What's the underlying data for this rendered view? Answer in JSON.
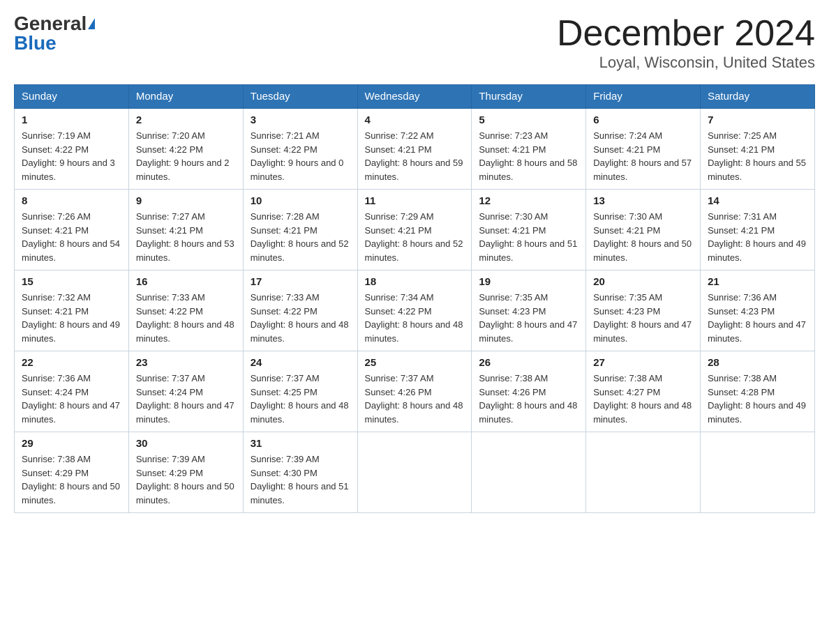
{
  "header": {
    "logo_general": "General",
    "logo_blue": "Blue",
    "month_title": "December 2024",
    "location": "Loyal, Wisconsin, United States"
  },
  "days_of_week": [
    "Sunday",
    "Monday",
    "Tuesday",
    "Wednesday",
    "Thursday",
    "Friday",
    "Saturday"
  ],
  "weeks": [
    [
      {
        "day": "1",
        "sunrise": "7:19 AM",
        "sunset": "4:22 PM",
        "daylight": "9 hours and 3 minutes."
      },
      {
        "day": "2",
        "sunrise": "7:20 AM",
        "sunset": "4:22 PM",
        "daylight": "9 hours and 2 minutes."
      },
      {
        "day": "3",
        "sunrise": "7:21 AM",
        "sunset": "4:22 PM",
        "daylight": "9 hours and 0 minutes."
      },
      {
        "day": "4",
        "sunrise": "7:22 AM",
        "sunset": "4:21 PM",
        "daylight": "8 hours and 59 minutes."
      },
      {
        "day": "5",
        "sunrise": "7:23 AM",
        "sunset": "4:21 PM",
        "daylight": "8 hours and 58 minutes."
      },
      {
        "day": "6",
        "sunrise": "7:24 AM",
        "sunset": "4:21 PM",
        "daylight": "8 hours and 57 minutes."
      },
      {
        "day": "7",
        "sunrise": "7:25 AM",
        "sunset": "4:21 PM",
        "daylight": "8 hours and 55 minutes."
      }
    ],
    [
      {
        "day": "8",
        "sunrise": "7:26 AM",
        "sunset": "4:21 PM",
        "daylight": "8 hours and 54 minutes."
      },
      {
        "day": "9",
        "sunrise": "7:27 AM",
        "sunset": "4:21 PM",
        "daylight": "8 hours and 53 minutes."
      },
      {
        "day": "10",
        "sunrise": "7:28 AM",
        "sunset": "4:21 PM",
        "daylight": "8 hours and 52 minutes."
      },
      {
        "day": "11",
        "sunrise": "7:29 AM",
        "sunset": "4:21 PM",
        "daylight": "8 hours and 52 minutes."
      },
      {
        "day": "12",
        "sunrise": "7:30 AM",
        "sunset": "4:21 PM",
        "daylight": "8 hours and 51 minutes."
      },
      {
        "day": "13",
        "sunrise": "7:30 AM",
        "sunset": "4:21 PM",
        "daylight": "8 hours and 50 minutes."
      },
      {
        "day": "14",
        "sunrise": "7:31 AM",
        "sunset": "4:21 PM",
        "daylight": "8 hours and 49 minutes."
      }
    ],
    [
      {
        "day": "15",
        "sunrise": "7:32 AM",
        "sunset": "4:21 PM",
        "daylight": "8 hours and 49 minutes."
      },
      {
        "day": "16",
        "sunrise": "7:33 AM",
        "sunset": "4:22 PM",
        "daylight": "8 hours and 48 minutes."
      },
      {
        "day": "17",
        "sunrise": "7:33 AM",
        "sunset": "4:22 PM",
        "daylight": "8 hours and 48 minutes."
      },
      {
        "day": "18",
        "sunrise": "7:34 AM",
        "sunset": "4:22 PM",
        "daylight": "8 hours and 48 minutes."
      },
      {
        "day": "19",
        "sunrise": "7:35 AM",
        "sunset": "4:23 PM",
        "daylight": "8 hours and 47 minutes."
      },
      {
        "day": "20",
        "sunrise": "7:35 AM",
        "sunset": "4:23 PM",
        "daylight": "8 hours and 47 minutes."
      },
      {
        "day": "21",
        "sunrise": "7:36 AM",
        "sunset": "4:23 PM",
        "daylight": "8 hours and 47 minutes."
      }
    ],
    [
      {
        "day": "22",
        "sunrise": "7:36 AM",
        "sunset": "4:24 PM",
        "daylight": "8 hours and 47 minutes."
      },
      {
        "day": "23",
        "sunrise": "7:37 AM",
        "sunset": "4:24 PM",
        "daylight": "8 hours and 47 minutes."
      },
      {
        "day": "24",
        "sunrise": "7:37 AM",
        "sunset": "4:25 PM",
        "daylight": "8 hours and 48 minutes."
      },
      {
        "day": "25",
        "sunrise": "7:37 AM",
        "sunset": "4:26 PM",
        "daylight": "8 hours and 48 minutes."
      },
      {
        "day": "26",
        "sunrise": "7:38 AM",
        "sunset": "4:26 PM",
        "daylight": "8 hours and 48 minutes."
      },
      {
        "day": "27",
        "sunrise": "7:38 AM",
        "sunset": "4:27 PM",
        "daylight": "8 hours and 48 minutes."
      },
      {
        "day": "28",
        "sunrise": "7:38 AM",
        "sunset": "4:28 PM",
        "daylight": "8 hours and 49 minutes."
      }
    ],
    [
      {
        "day": "29",
        "sunrise": "7:38 AM",
        "sunset": "4:29 PM",
        "daylight": "8 hours and 50 minutes."
      },
      {
        "day": "30",
        "sunrise": "7:39 AM",
        "sunset": "4:29 PM",
        "daylight": "8 hours and 50 minutes."
      },
      {
        "day": "31",
        "sunrise": "7:39 AM",
        "sunset": "4:30 PM",
        "daylight": "8 hours and 51 minutes."
      },
      null,
      null,
      null,
      null
    ]
  ]
}
